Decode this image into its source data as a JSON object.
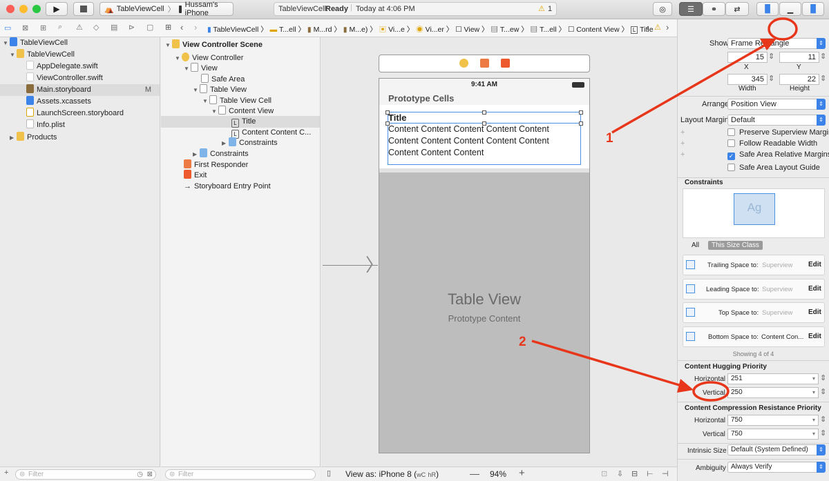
{
  "toolbar": {
    "scheme": "TableViewCell",
    "device": "Hussam's iPhone",
    "status_app": "TableViewCell:",
    "status_state": "Ready",
    "status_time": "Today at 4:06 PM",
    "warning_count": "1"
  },
  "jump": {
    "items": [
      "TableViewCell",
      "T...ell",
      "M...rd",
      "M...e)",
      "Vi...e",
      "Vi...er",
      "View",
      "T...ew",
      "T...ell",
      "Content View",
      "Title"
    ]
  },
  "navigator": {
    "items": [
      {
        "label": "TableViewCell"
      },
      {
        "label": "TableViewCell"
      },
      {
        "label": "AppDelegate.swift"
      },
      {
        "label": "ViewController.swift"
      },
      {
        "label": "Main.storyboard",
        "badge": "M"
      },
      {
        "label": "Assets.xcassets"
      },
      {
        "label": "LaunchScreen.storyboard"
      },
      {
        "label": "Info.plist"
      },
      {
        "label": "Products"
      }
    ],
    "filter_placeholder": "Filter"
  },
  "outline": {
    "items": [
      "View Controller Scene",
      "View Controller",
      "View",
      "Safe Area",
      "Table View",
      "Table View Cell",
      "Content View",
      "Title",
      "Content Content C...",
      "Constraints",
      "Constraints",
      "First Responder",
      "Exit",
      "Storyboard Entry Point"
    ],
    "filter_placeholder": "Filter"
  },
  "canvas": {
    "time": "9:41 AM",
    "section": "Prototype Cells",
    "cell_title": "Title",
    "cell_content": [
      "Content Content Content Content Content",
      "Content Content Content Content Content",
      "Content Content Content"
    ],
    "table_view": "Table View",
    "prototype_content": "Prototype Content",
    "view_as": "View as: iPhone 8 (",
    "size_class_w": "wC",
    "size_class_h": "hR",
    ")": ")",
    "zoom": "94%"
  },
  "inspector": {
    "show_label": "Show",
    "show_value": "Frame Rectangle",
    "x": "15",
    "y": "11",
    "x_label": "X",
    "y_label": "Y",
    "width": "345",
    "height": "22",
    "width_label": "Width",
    "height_label": "Height",
    "arrange_label": "Arrange",
    "arrange_value": "Position View",
    "layout_margins_label": "Layout Margins",
    "layout_margins_value": "Default",
    "checks": [
      "Preserve Superview Margins",
      "Follow Readable Width",
      "Safe Area Relative Margins",
      "Safe Area Layout Guide"
    ],
    "constraints_title": "Constraints",
    "ag": "Ag",
    "tab_all": "All",
    "tab_size": "This Size Class",
    "constraints": [
      {
        "label": "Trailing Space to:",
        "target": "Superview",
        "edit": "Edit"
      },
      {
        "label": "Leading Space to:",
        "target": "Superview",
        "edit": "Edit"
      },
      {
        "label": "Top Space to:",
        "target": "Superview",
        "edit": "Edit"
      },
      {
        "label": "Bottom Space to:",
        "target": "Content Con...",
        "edit": "Edit"
      }
    ],
    "showing": "Showing 4 of 4",
    "hugging_title": "Content Hugging Priority",
    "h_label": "Horizontal",
    "h_value": "251",
    "v_label": "Vertical",
    "v_value": "250",
    "compression_title": "Content Compression Resistance Priority",
    "ch_value": "750",
    "cv_value": "750",
    "intrinsic_label": "Intrinsic Size",
    "intrinsic_value": "Default (System Defined)",
    "ambiguity_label": "Ambiguity",
    "ambiguity_value": "Always Verify"
  },
  "annotations": {
    "one": "1",
    "two": "2"
  },
  "colors": {
    "accent": "#3b83e9",
    "annotation": "#e8361b"
  }
}
